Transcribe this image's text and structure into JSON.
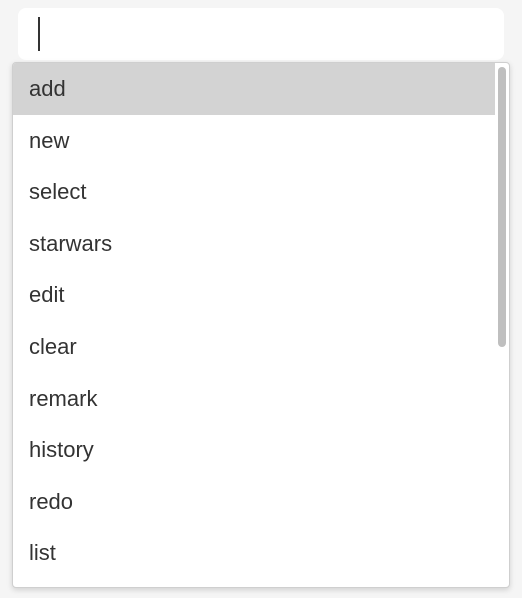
{
  "input": {
    "value": "",
    "placeholder": ""
  },
  "dropdown": {
    "items": [
      {
        "label": "add",
        "highlighted": true
      },
      {
        "label": "new",
        "highlighted": false
      },
      {
        "label": "select",
        "highlighted": false
      },
      {
        "label": "starwars",
        "highlighted": false
      },
      {
        "label": "edit",
        "highlighted": false
      },
      {
        "label": "clear",
        "highlighted": false
      },
      {
        "label": "remark",
        "highlighted": false
      },
      {
        "label": "history",
        "highlighted": false
      },
      {
        "label": "redo",
        "highlighted": false
      },
      {
        "label": "list",
        "highlighted": false
      }
    ]
  }
}
